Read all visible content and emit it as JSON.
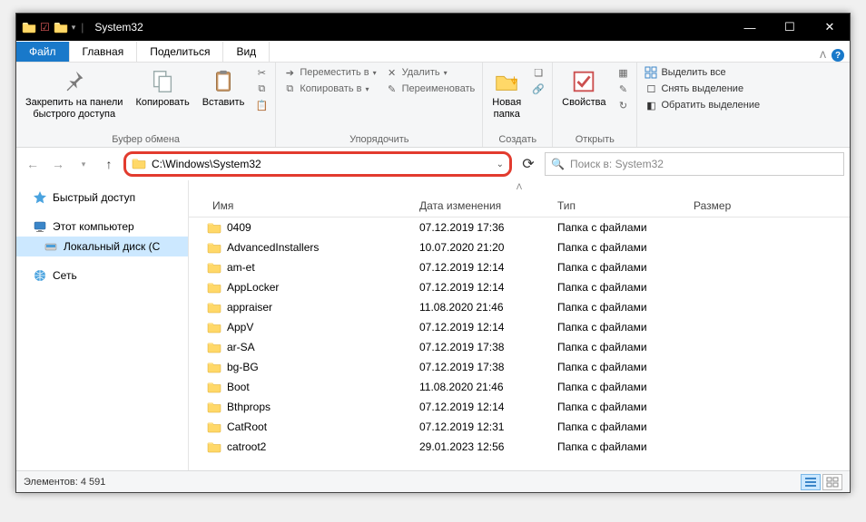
{
  "title": "System32",
  "tabs": {
    "file": "Файл",
    "home": "Главная",
    "share": "Поделиться",
    "view": "Вид"
  },
  "ribbon": {
    "clipboard": {
      "pin": "Закрепить на панели\nбыстрого доступа",
      "copy": "Копировать",
      "paste": "Вставить",
      "caption": "Буфер обмена"
    },
    "organize": {
      "moveTo": "Переместить в",
      "copyTo": "Копировать в",
      "delete": "Удалить",
      "rename": "Переименовать",
      "caption": "Упорядочить"
    },
    "new": {
      "newFolder": "Новая\nпапка",
      "caption": "Создать"
    },
    "open": {
      "properties": "Свойства",
      "caption": "Открыть"
    },
    "select": {
      "selectAll": "Выделить все",
      "selectNone": "Снять выделение",
      "invert": "Обратить выделение"
    }
  },
  "address": {
    "path": "C:\\Windows\\System32"
  },
  "search": {
    "placeholder": "Поиск в: System32"
  },
  "sidebar": {
    "quick": "Быстрый доступ",
    "thispc": "Этот компьютер",
    "localdisk": "Локальный диск (C",
    "network": "Сеть"
  },
  "columns": {
    "name": "Имя",
    "date": "Дата изменения",
    "type": "Тип",
    "size": "Размер"
  },
  "folderType": "Папка с файлами",
  "files": [
    {
      "name": "0409",
      "date": "07.12.2019 17:36"
    },
    {
      "name": "AdvancedInstallers",
      "date": "10.07.2020 21:20"
    },
    {
      "name": "am-et",
      "date": "07.12.2019 12:14"
    },
    {
      "name": "AppLocker",
      "date": "07.12.2019 12:14"
    },
    {
      "name": "appraiser",
      "date": "11.08.2020 21:46"
    },
    {
      "name": "AppV",
      "date": "07.12.2019 12:14"
    },
    {
      "name": "ar-SA",
      "date": "07.12.2019 17:38"
    },
    {
      "name": "bg-BG",
      "date": "07.12.2019 17:38"
    },
    {
      "name": "Boot",
      "date": "11.08.2020 21:46"
    },
    {
      "name": "Bthprops",
      "date": "07.12.2019 12:14"
    },
    {
      "name": "CatRoot",
      "date": "07.12.2019 12:31"
    },
    {
      "name": "catroot2",
      "date": "29.01.2023 12:56"
    }
  ],
  "status": {
    "items": "Элементов: 4 591"
  }
}
